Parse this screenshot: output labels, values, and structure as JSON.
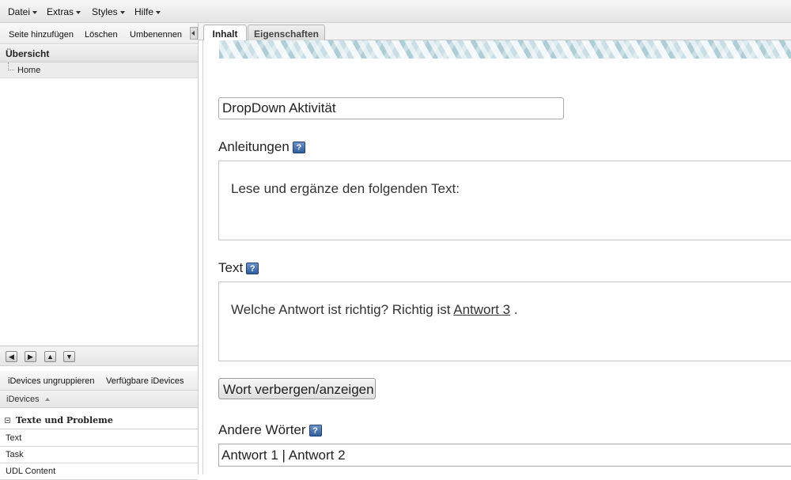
{
  "menubar": {
    "items": [
      {
        "label": "Datei"
      },
      {
        "label": "Extras"
      },
      {
        "label": "Styles"
      },
      {
        "label": "Hilfe"
      }
    ]
  },
  "outline": {
    "toolbar": {
      "add_page": "Seite hinzufügen",
      "delete": "Löschen",
      "rename": "Umbenennen"
    },
    "heading": "Übersicht",
    "nodes": [
      {
        "label": "Home"
      }
    ],
    "nav": {
      "left": "◀",
      "right": "▶",
      "up": "▲",
      "down": "▼"
    }
  },
  "idevices": {
    "toolbar": {
      "ungroup": "iDevices ungruppieren",
      "available": "Verfügbare iDevices"
    },
    "heading": "iDevices",
    "group": "Texte und Probleme",
    "items": [
      {
        "label": "Text"
      },
      {
        "label": "Task"
      },
      {
        "label": "UDL Content"
      }
    ]
  },
  "tabs": [
    {
      "label": "Inhalt",
      "active": true
    },
    {
      "label": "Eigenschaften",
      "active": false
    }
  ],
  "editor": {
    "title_value": "DropDown Aktivität",
    "instructions_label": "Anleitungen",
    "instructions_text": "Lese und ergänze den folgenden Text:",
    "text_label": "Text",
    "text_before": "Welche Antwort ist richtig? Richtig ist ",
    "text_hidden_word": "Antwort 3",
    "text_after": " .",
    "toggle_button": "Wort verbergen/anzeigen",
    "other_words_label": "Andere Wörter",
    "other_words_value": "Antwort 1 | Antwort 2",
    "help_glyph": "?"
  },
  "colors": {
    "help_icon": "#2f5f9e",
    "banner": "#a0c4ce"
  }
}
